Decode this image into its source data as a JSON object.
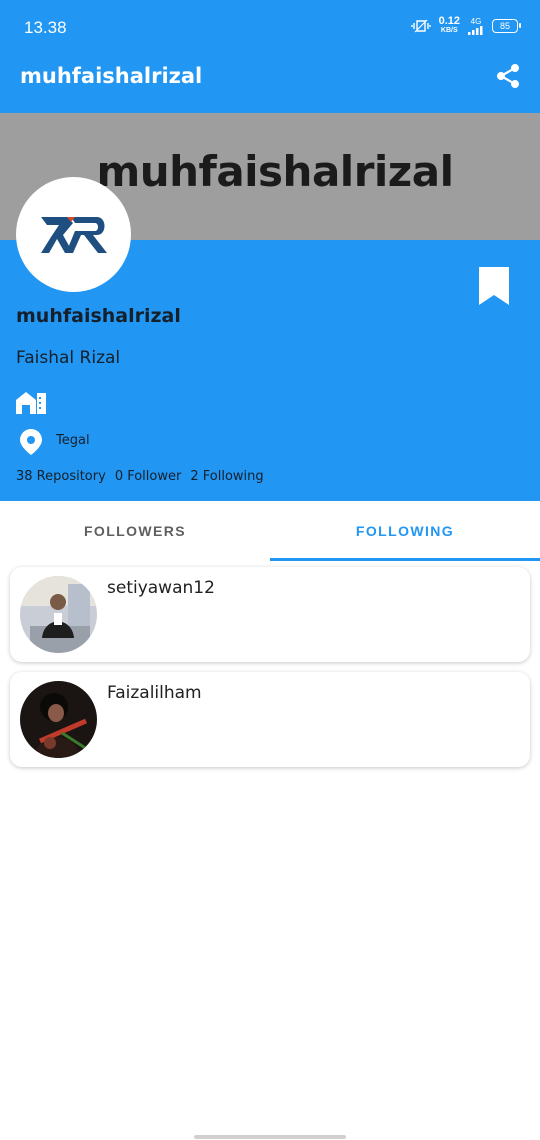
{
  "status_bar": {
    "time": "13.38",
    "net_speed_value": "0.12",
    "net_speed_unit": "KB/S",
    "network": "4G",
    "battery": "85"
  },
  "app_bar": {
    "title": "muhfaishalrizal",
    "share_icon": "share-icon"
  },
  "banner": {
    "text": "muhfaishalrizal"
  },
  "profile": {
    "avatar_icon": "logo-icon",
    "bookmark_icon": "bookmark-icon",
    "username": "muhfaishalrizal",
    "full_name": "Faishal Rizal",
    "company_icon": "company-icon",
    "location_icon": "location-pin-icon",
    "location": "Tegal",
    "stats": {
      "repositories": "38 Repository",
      "followers": "0 Follower",
      "following": "2 Following"
    }
  },
  "tabs": [
    {
      "label": "FOLLOWERS",
      "active": false
    },
    {
      "label": "FOLLOWING",
      "active": true
    }
  ],
  "following_list": [
    {
      "name": "setiyawan12"
    },
    {
      "name": "Faizalilham"
    }
  ],
  "colors": {
    "primary": "#2196F3",
    "banner_gray": "#9e9e9e",
    "text_dark": "#15202b"
  }
}
